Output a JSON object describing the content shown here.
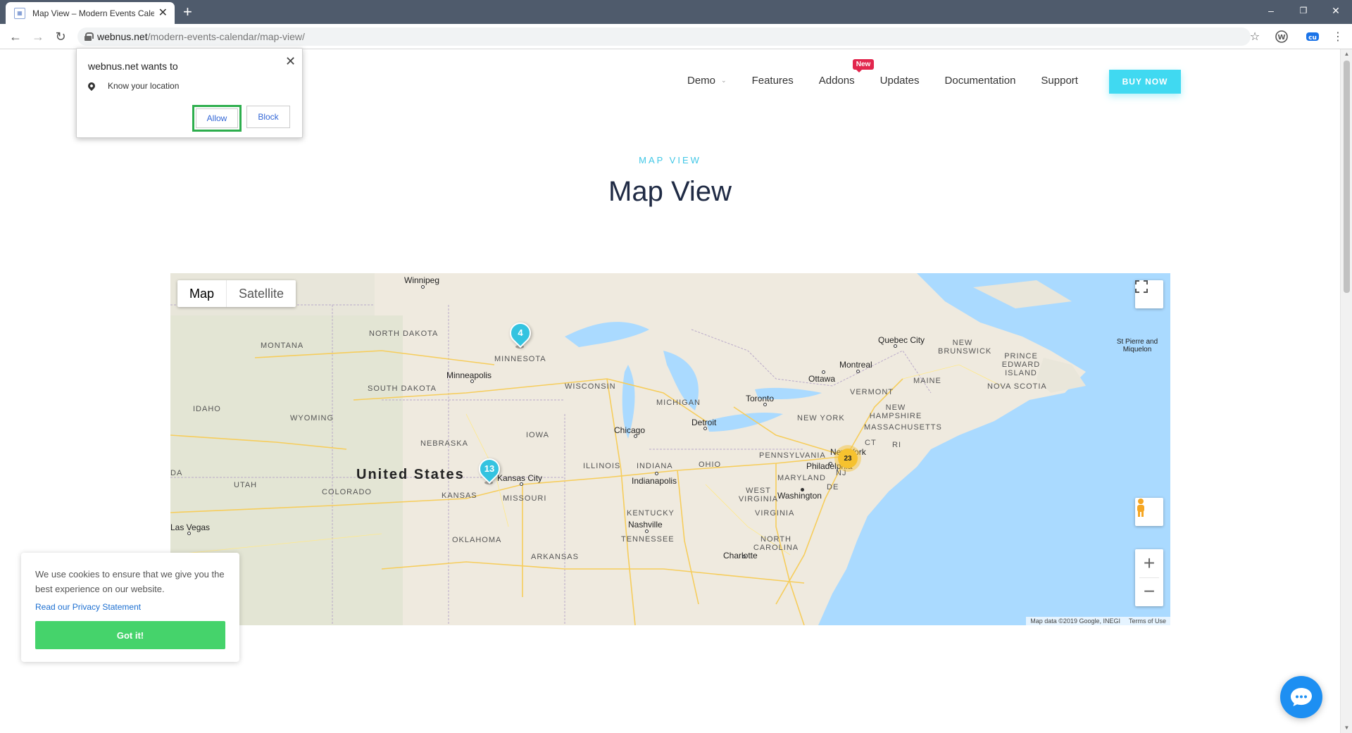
{
  "browser": {
    "tab_title": "Map View – Modern Events Cale",
    "new_tab": "+",
    "url_host": "webnus.net",
    "url_path": "/modern-events-calendar/map-view/",
    "window_controls": {
      "minimize": "–",
      "restore": "❐",
      "close": "✕"
    }
  },
  "permission_popup": {
    "title": "webnus.net wants to",
    "request": "Know your location",
    "allow": "Allow",
    "block": "Block",
    "close": "✕"
  },
  "nav": {
    "items": [
      {
        "label": "Demo",
        "has_dropdown": true
      },
      {
        "label": "Features"
      },
      {
        "label": "Addons",
        "badge": "New"
      },
      {
        "label": "Updates"
      },
      {
        "label": "Documentation"
      },
      {
        "label": "Support"
      }
    ],
    "cta": "BUY NOW"
  },
  "section": {
    "kicker": "MAP VIEW",
    "title": "Map View"
  },
  "map": {
    "type_buttons": [
      "Map",
      "Satellite"
    ],
    "active_type": "Map",
    "country_label": "United States",
    "cities": [
      "Winnipeg",
      "Minneapolis",
      "Chicago",
      "Detroit",
      "Toronto",
      "Ottawa",
      "Montreal",
      "Quebec City",
      "Kansas City",
      "Indianapolis",
      "Nashville",
      "Charlotte",
      "Washington",
      "Philadelphia",
      "New York",
      "Las Vegas",
      "St Pierre and Miquelon"
    ],
    "states": [
      "NORTH DAKOTA",
      "MONTANA",
      "MINNESOTA",
      "SOUTH DAKOTA",
      "IDAHO",
      "WYOMING",
      "WISCONSIN",
      "MICHIGAN",
      "IOWA",
      "NEBRASKA",
      "UTAH",
      "COLORADO",
      "KANSAS",
      "MISSOURI",
      "ILLINOIS",
      "INDIANA",
      "OHIO",
      "PENNSYLVANIA",
      "NEW YORK",
      "VERMONT",
      "NEW HAMPSHIRE",
      "MASSACHUSETTS",
      "MAINE",
      "NEW BRUNSWICK",
      "PRINCE EDWARD ISLAND",
      "NOVA SCOTIA",
      "MARYLAND",
      "WEST VIRGINIA",
      "VIRGINIA",
      "KENTUCKY",
      "TENNESSEE",
      "NORTH CAROLINA",
      "OKLAHOMA",
      "ARKANSAS",
      "CT",
      "RI",
      "NJ",
      "DE",
      "DA"
    ],
    "markers": [
      {
        "label": "4",
        "kind": "pin",
        "color": "#34c3e0",
        "location": "Minnesota"
      },
      {
        "label": "13",
        "kind": "pin",
        "color": "#34c3e0",
        "location": "Kansas City"
      },
      {
        "label": "23",
        "kind": "cluster",
        "color": "#f6c22f",
        "location": "New York"
      }
    ],
    "attribution": "Map data ©2019 Google, INEGI",
    "terms": "Terms of Use",
    "zoom_in": "+",
    "zoom_out": "−"
  },
  "cookie": {
    "text": "We use cookies to ensure that we give you the best experience on our website.",
    "link": "Read our Privacy Statement",
    "button": "Got it!"
  },
  "colors": {
    "accent": "#40d9f1",
    "title": "#1f2a44",
    "badge": "#e2264d",
    "cookie_button": "#45d36b",
    "chat": "#1d8ff2",
    "water": "#aadaff"
  }
}
